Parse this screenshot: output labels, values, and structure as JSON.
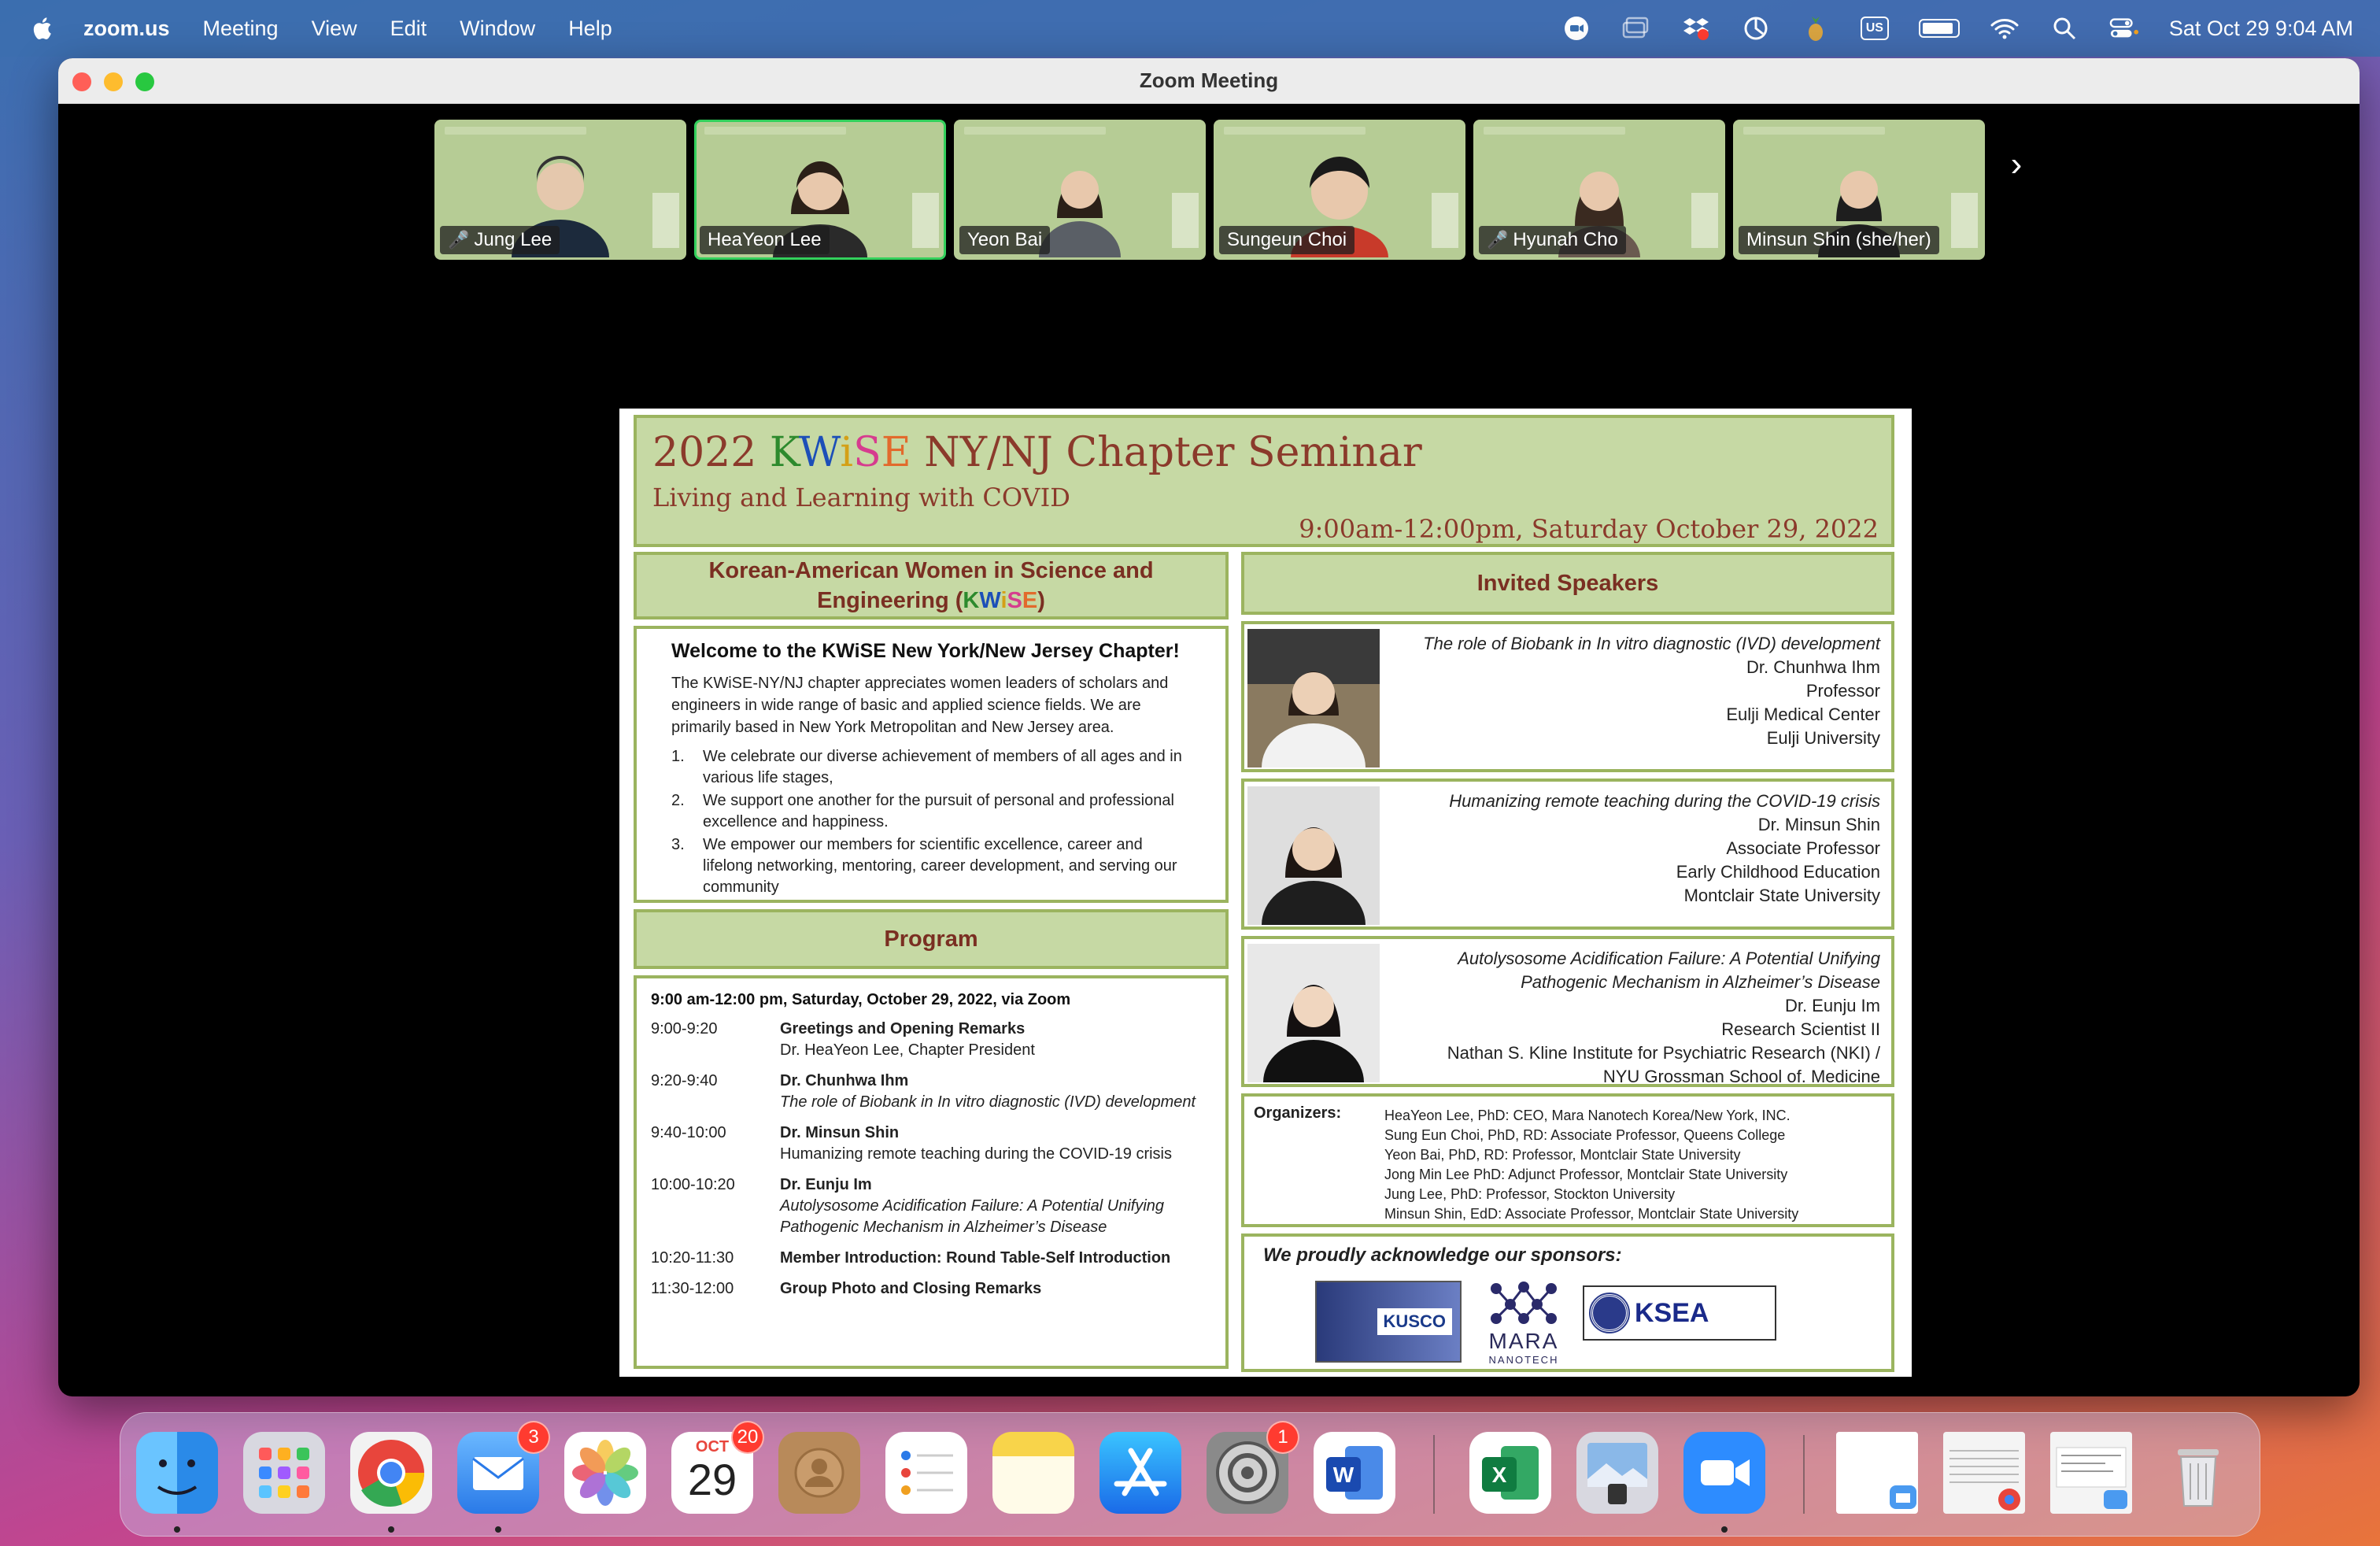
{
  "menubar": {
    "app_name": "zoom.us",
    "items": [
      "Meeting",
      "View",
      "Edit",
      "Window",
      "Help"
    ],
    "input_source": "US",
    "clock": "Sat Oct 29  9:04 AM"
  },
  "window": {
    "title": "Zoom Meeting"
  },
  "participants": [
    {
      "name": "Jung Lee",
      "muted": true,
      "active": false
    },
    {
      "name": "HeaYeon Lee",
      "muted": false,
      "active": true
    },
    {
      "name": "Yeon Bai",
      "muted": false,
      "active": false
    },
    {
      "name": "Sungeun Choi",
      "muted": false,
      "active": false
    },
    {
      "name": "Hyunah Cho",
      "muted": true,
      "active": false
    },
    {
      "name": "Minsun Shin (she/her)",
      "muted": false,
      "active": false
    }
  ],
  "slide": {
    "title_prefix": "2022",
    "title_suffix": "NY/NJ Chapter Seminar",
    "subtitle": "Living and Learning with COVID",
    "datetime": "9:00am-12:00pm, Saturday October 29, 2022",
    "kwise_head_line1": "Korean-American Women in Science and",
    "kwise_head_line2": "Engineering (",
    "kwise_head_close": ")",
    "welcome_title": "Welcome to the KWiSE New York/New Jersey Chapter!",
    "welcome_text": "The KWiSE-NY/NJ chapter appreciates women leaders of scholars and engineers in wide range of basic and applied science fields. We are primarily based in New York Metropolitan and New Jersey area.",
    "welcome_list": [
      "We celebrate our diverse achievement of members of all ages and in various life stages,",
      "We support one another for the pursuit of personal and professional excellence and happiness.",
      "We empower our members for scientific excellence, career and lifelong networking, mentoring, career development, and serving our community"
    ],
    "program_head": "Program",
    "program_date": "9:00 am-12:00 pm, Saturday, October 29, 2022, via Zoom",
    "program": [
      {
        "time": "9:00-9:20",
        "title": "Greetings and Opening Remarks",
        "sub": "Dr. HeaYeon Lee, Chapter President",
        "italic": false
      },
      {
        "time": "9:20-9:40",
        "title": "Dr. Chunhwa Ihm",
        "sub": "The role of Biobank in In vitro diagnostic (IVD) development",
        "italic": true
      },
      {
        "time": "9:40-10:00",
        "title": "Dr. Minsun Shin",
        "sub": "Humanizing remote teaching during the COVID-19 crisis",
        "italic": false
      },
      {
        "time": "10:00-10:20",
        "title": "Dr. Eunju Im",
        "sub": "Autolysosome Acidification Failure: A Potential Unifying Pathogenic Mechanism in Alzheimer’s Disease",
        "italic": true
      },
      {
        "time": "10:20-11:30",
        "title": "Member Introduction: Round Table-Self Introduction",
        "sub": "",
        "italic": false
      },
      {
        "time": "11:30-12:00",
        "title": "Group Photo and Closing Remarks",
        "sub": "",
        "italic": false
      }
    ],
    "speakers_head": "Invited Speakers",
    "speakers": [
      {
        "talk": "The role of Biobank in In vitro diagnostic (IVD) development",
        "lines": [
          "Dr. Chunhwa Ihm",
          "Professor",
          "Eulji Medical Center",
          "Eulji University"
        ]
      },
      {
        "talk": "Humanizing remote teaching during the COVID-19 crisis",
        "lines": [
          "Dr. Minsun Shin",
          "Associate Professor",
          "Early Childhood Education",
          "Montclair State University"
        ]
      },
      {
        "talk": "Autolysosome Acidification Failure: A Potential Unifying Pathogenic Mechanism in Alzheimer’s Disease",
        "lines": [
          "Dr. Eunju Im",
          "Research Scientist II",
          "Nathan S. Kline Institute for Psychiatric Research (NKI) /",
          "NYU Grossman School of. Medicine"
        ]
      }
    ],
    "organizers_label": "Organizers:",
    "organizers": [
      "HeaYeon Lee, PhD: CEO, Mara Nanotech Korea/New York, INC.",
      "Sung Eun Choi, PhD, RD: Associate Professor, Queens College",
      "Yeon Bai, PhD, RD: Professor, Montclair State University",
      "Jong Min Lee PhD: Adjunct Professor, Montclair State University",
      "Jung Lee, PhD: Professor, Stockton University",
      "Minsun Shin, EdD: Associate Professor, Montclair State University"
    ],
    "sponsors_title": "We proudly acknowledge our sponsors:",
    "sponsor_logos": {
      "kusco": "KUSCO",
      "mara": "MARA",
      "mara_sub": "NANOTECH",
      "ksea": "KSEA"
    }
  },
  "dock": {
    "mail_badge": "3",
    "calendar_month": "OCT",
    "calendar_day": "29",
    "calendar_badge": "20",
    "settings_badge": "1"
  }
}
